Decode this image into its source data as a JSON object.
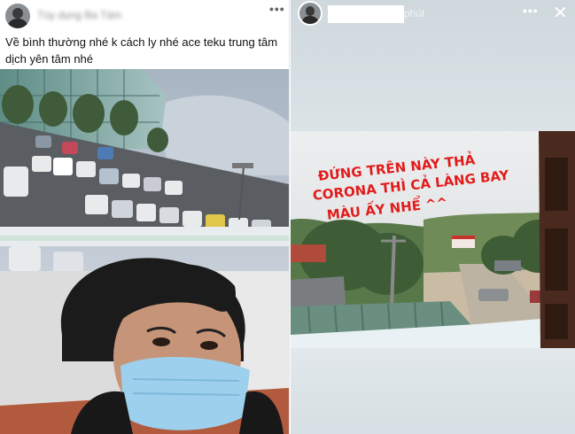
{
  "left_post": {
    "author_name": "Tùy dụng Ba Tám",
    "caption": "Về bình thường nhé k cách ly nhé ace teku trung tâm dịch yên tâm nhé",
    "more_icon": "ellipsis-icon"
  },
  "right_story": {
    "time": "phút",
    "story_text_line1": "ĐỨNG TRÊN NÀY THẢ",
    "story_text_line2": "CORONA THÌ CẢ LÀNG BAY",
    "story_text_line3": "MÀU ẤY NHỂ ^^",
    "more_icon": "ellipsis-icon",
    "close_icon": "close-icon",
    "text_color": "#e01b1b"
  }
}
